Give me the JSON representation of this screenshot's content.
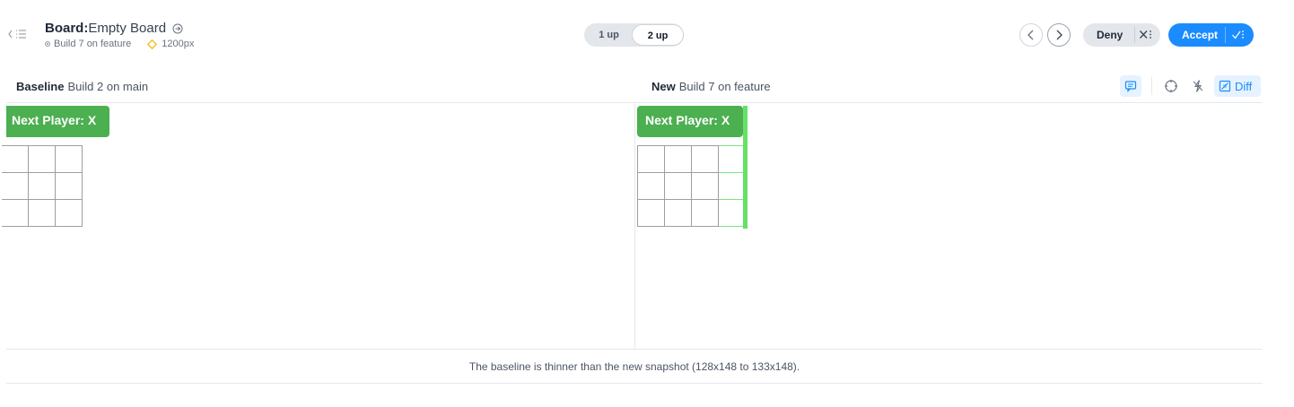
{
  "header": {
    "title_key": "Board:",
    "title_value": "Empty Board",
    "build_label": "Build 7 on feature",
    "viewport_label": "1200px"
  },
  "view_toggle": {
    "option_1": "1 up",
    "option_2": "2 up",
    "selected": "2 up"
  },
  "actions": {
    "deny_label": "Deny",
    "accept_label": "Accept"
  },
  "panes": {
    "baseline": {
      "label": "Baseline",
      "build": "Build 2 on main"
    },
    "new": {
      "label": "New",
      "build": "Build 7 on feature"
    }
  },
  "tools": {
    "diff_label": "Diff",
    "diff_active": true
  },
  "snapshot": {
    "banner_text": "Next Player: X"
  },
  "status_message": "The baseline is thinner than the new snapshot (128x148 to 133x148).",
  "colors": {
    "accent": "#1a8cff",
    "banner": "#4caf50",
    "diff_highlight": "#66e066"
  }
}
